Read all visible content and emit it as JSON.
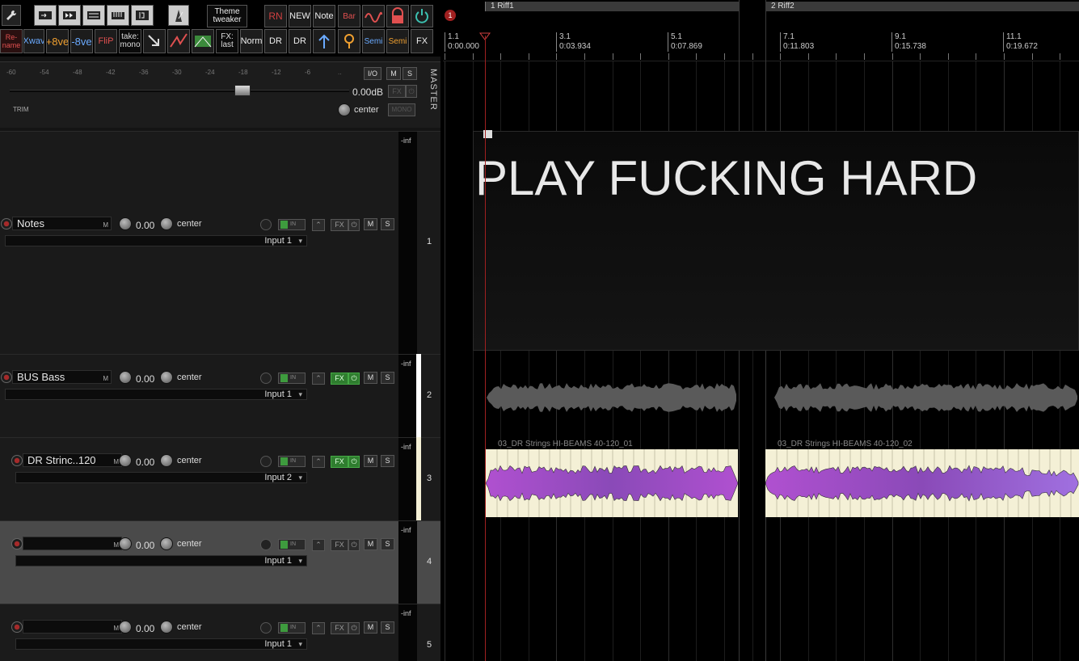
{
  "toolbar": {
    "theme_tweaker": "Theme tweaker",
    "take_mono": "take: mono",
    "fx_last": "FX: last",
    "norm": "Norm",
    "rn": "RN",
    "new": "NEW",
    "note": "Note",
    "bar": "Bar",
    "semi": "Semi",
    "fx": "FX",
    "rename": "Re-name",
    "xwav": "Xwav",
    "ove1": "+8ve",
    "ove2": "-8ve",
    "flip": "FliP",
    "dr": "DR"
  },
  "master": {
    "label": "MASTER",
    "scale": [
      "-60",
      "-54",
      "-48",
      "-42",
      "-36",
      "-30",
      "-24",
      "-18",
      "-12",
      "-6",
      ".."
    ],
    "io": "I/O",
    "m": "M",
    "s": "S",
    "volume": "0.00dB",
    "fx": "FX",
    "trim": "TRIM",
    "pan": "center",
    "mono": "MONO"
  },
  "tracks": [
    {
      "name": "Notes",
      "vol": "0.00",
      "pan": "center",
      "input": "Input 1",
      "num": "1",
      "meter": "-inf",
      "in_lbl": "IN",
      "fx": "FX",
      "m": "M",
      "s": "S",
      "nm_m": "M"
    },
    {
      "name": "BUS Bass",
      "vol": "0.00",
      "pan": "center",
      "input": "Input 1",
      "num": "2",
      "meter": "-inf",
      "in_lbl": "IN",
      "fx": "FX",
      "m": "M",
      "s": "S",
      "nm_m": "M"
    },
    {
      "name": "DR Strinc..120",
      "vol": "0.00",
      "pan": "center",
      "input": "Input 2",
      "num": "3",
      "meter": "-inf",
      "in_lbl": "IN",
      "fx": "FX",
      "m": "M",
      "s": "S",
      "nm_m": "M"
    },
    {
      "name": "",
      "vol": "0.00",
      "pan": "center",
      "input": "Input 1",
      "num": "4",
      "meter": "-inf",
      "in_lbl": "IN",
      "fx": "FX",
      "m": "M",
      "s": "S",
      "nm_m": "M"
    },
    {
      "name": "",
      "vol": "0.00",
      "pan": "center",
      "input": "Input 1",
      "num": "5",
      "meter": "-inf",
      "in_lbl": "IN",
      "fx": "FX",
      "m": "M",
      "s": "S",
      "nm_m": "M"
    }
  ],
  "ruler": {
    "marker_num": "1",
    "regions": [
      {
        "label": "1  Riff1"
      },
      {
        "label": "2  Riff2"
      }
    ],
    "marks": [
      {
        "bar": "1.1",
        "time": "0:00.000"
      },
      {
        "bar": "3.1",
        "time": "0:03.934"
      },
      {
        "bar": "5.1",
        "time": "0:07.869"
      },
      {
        "bar": "7.1",
        "time": "0:11.803"
      },
      {
        "bar": "9.1",
        "time": "0:15.738"
      },
      {
        "bar": "11.1",
        "time": "0:19.672"
      }
    ]
  },
  "arrange": {
    "notes_text": "PLAY FUCKING HARD",
    "item1": "03_DR Strings HI-BEAMS 40-120_01",
    "item2": "03_DR Strings HI-BEAMS 40-120_02"
  },
  "colors": {
    "item_bg": "#f4f0d6",
    "wave_purple": "#a855c8",
    "rec_red": "#a52a2a",
    "fx_green": "#2f7d2f"
  }
}
